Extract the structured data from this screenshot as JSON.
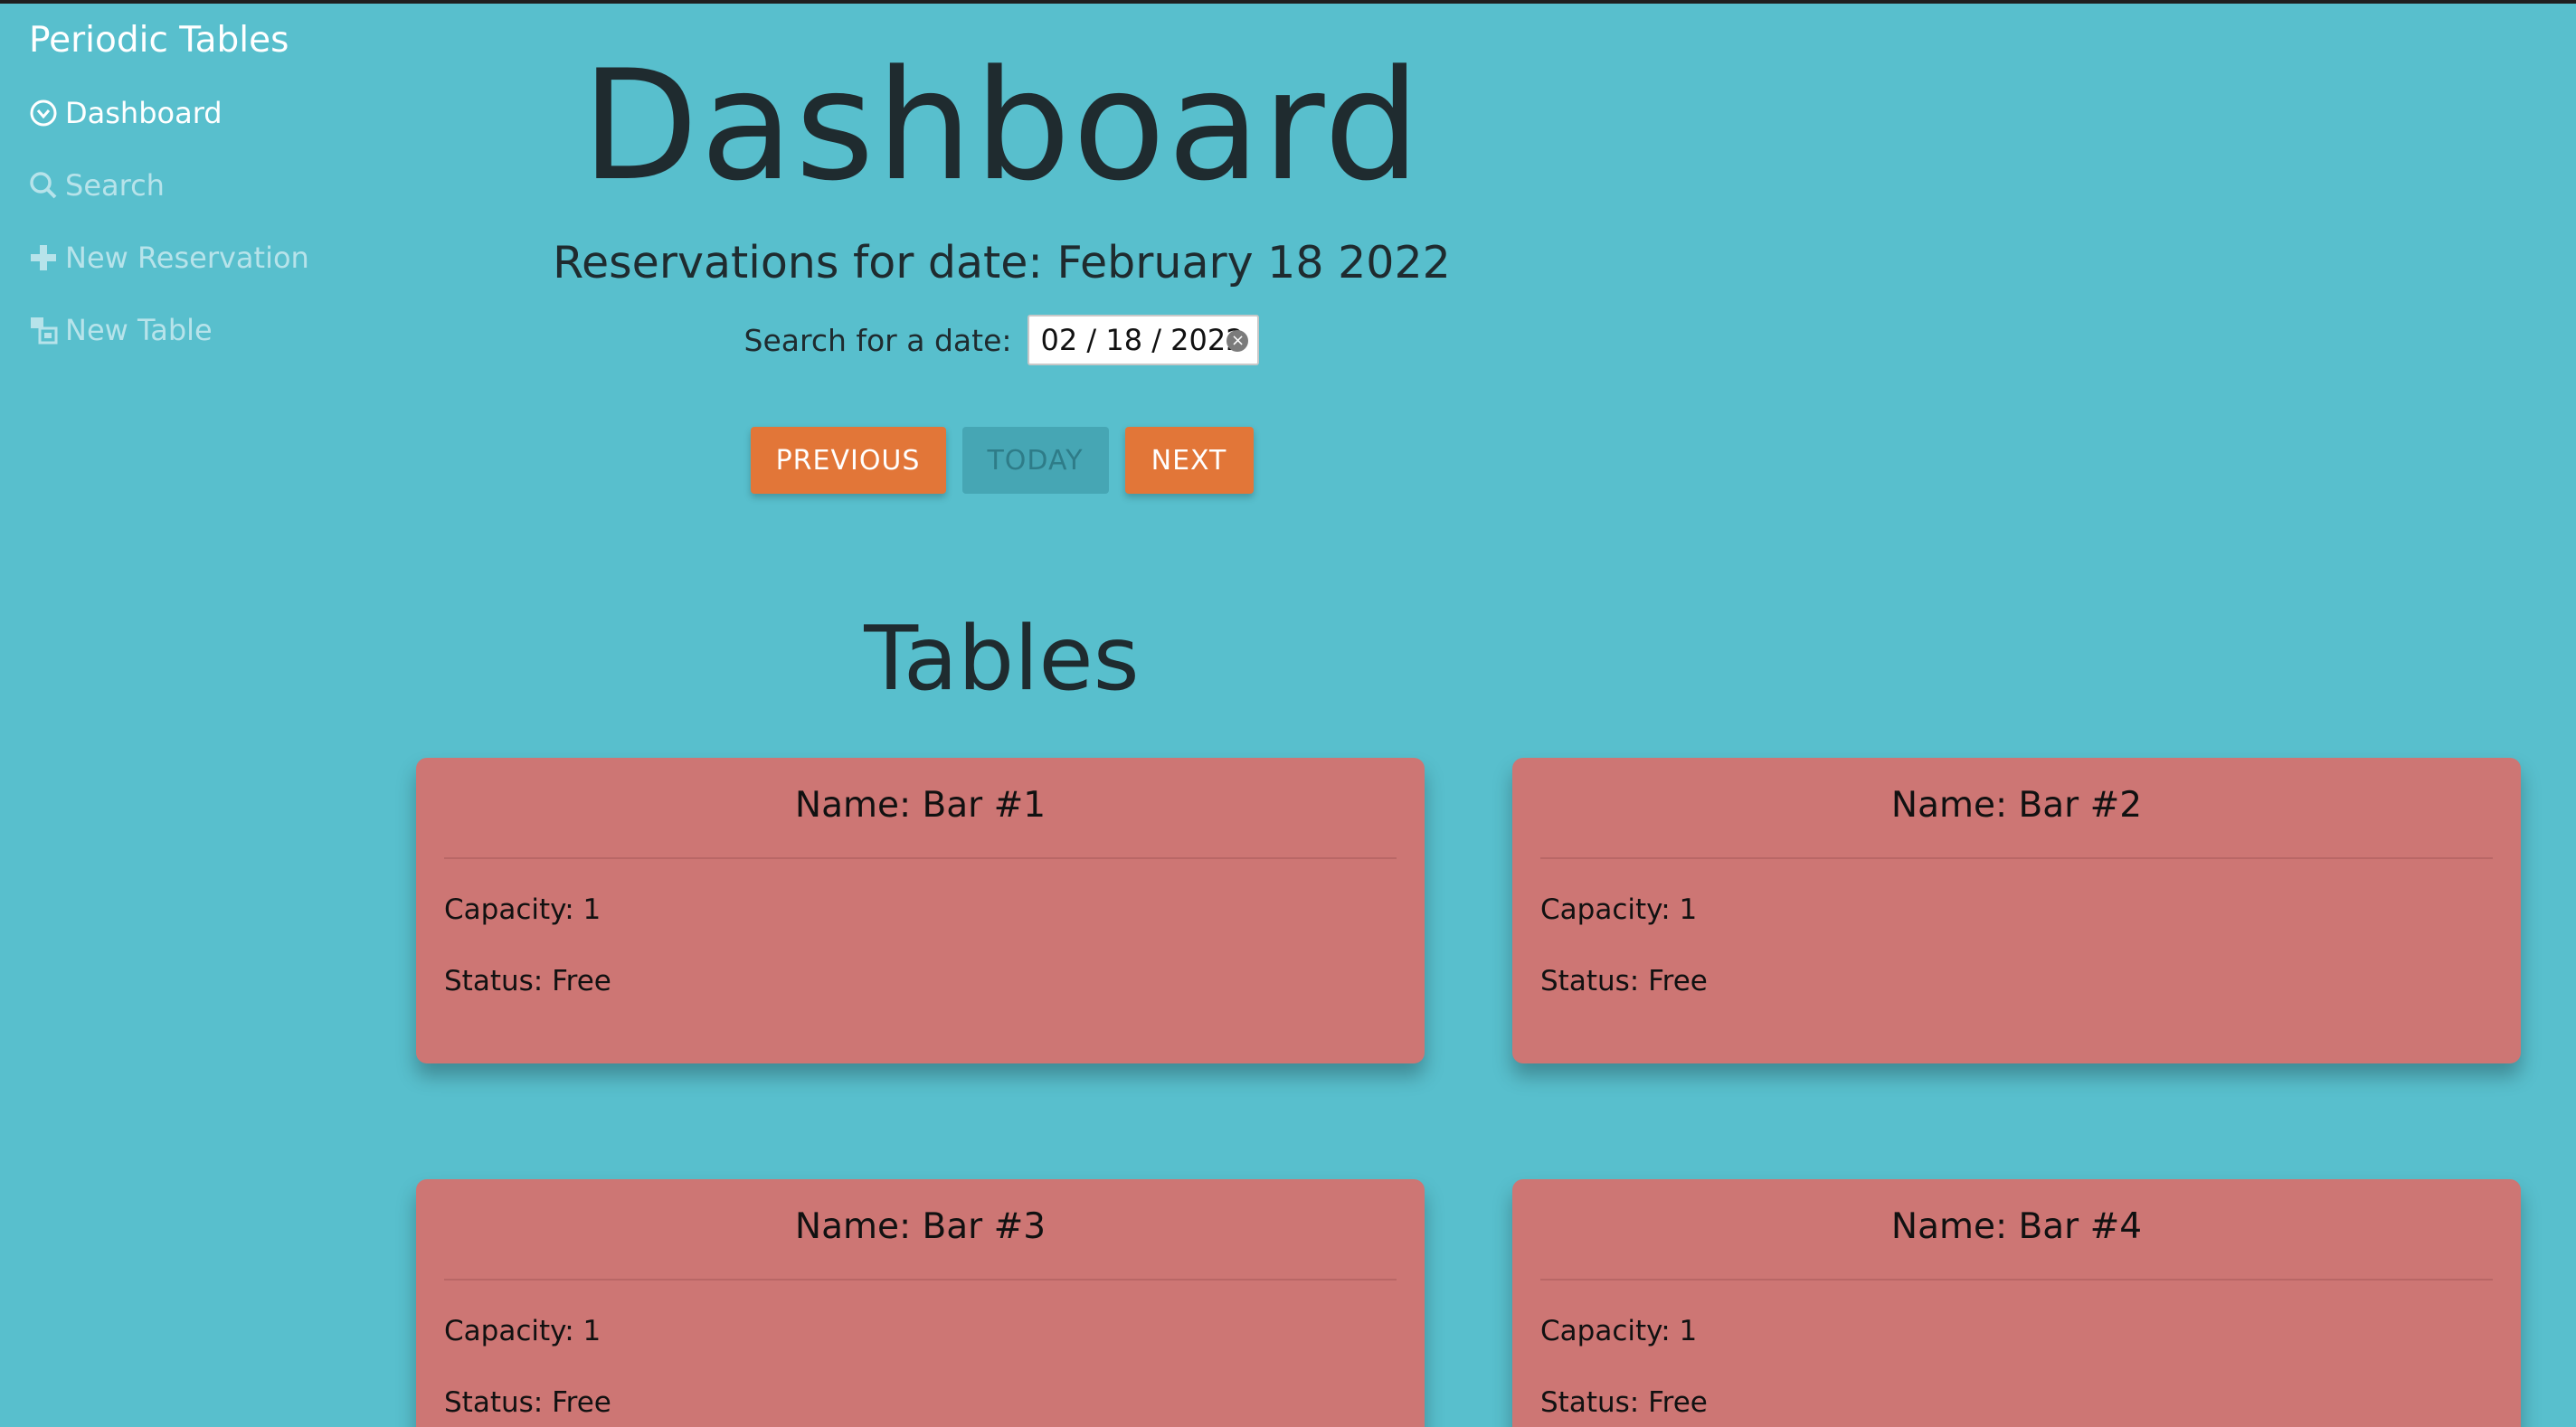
{
  "sidebar": {
    "brand": "Periodic Tables",
    "items": [
      {
        "label": "Dashboard",
        "icon": "dashboard-icon"
      },
      {
        "label": "Search",
        "icon": "search-icon"
      },
      {
        "label": "New Reservation",
        "icon": "plus-icon"
      },
      {
        "label": "New Table",
        "icon": "table-icon"
      }
    ]
  },
  "main": {
    "title": "Dashboard",
    "reservations_heading": "Reservations for date: February 18 2022",
    "date_search": {
      "label": "Search for a date:",
      "value": "02 / 18 / 2022"
    },
    "buttons": {
      "previous": "PREVIOUS",
      "today": "TODAY",
      "next": "NEXT"
    },
    "tables_heading": "Tables",
    "tables": [
      {
        "name": "Name: Bar #1",
        "capacity": "Capacity: 1",
        "status": "Status: Free"
      },
      {
        "name": "Name: Bar #2",
        "capacity": "Capacity: 1",
        "status": "Status: Free"
      },
      {
        "name": "Name: Bar #3",
        "capacity": "Capacity: 1",
        "status": "Status: Free"
      },
      {
        "name": "Name: Bar #4",
        "capacity": "Capacity: 1",
        "status": "Status: Free"
      }
    ]
  },
  "colors": {
    "background": "#58bfcd",
    "accent": "#e27638",
    "card": "#cd7674",
    "text": "#1f2b2f"
  }
}
